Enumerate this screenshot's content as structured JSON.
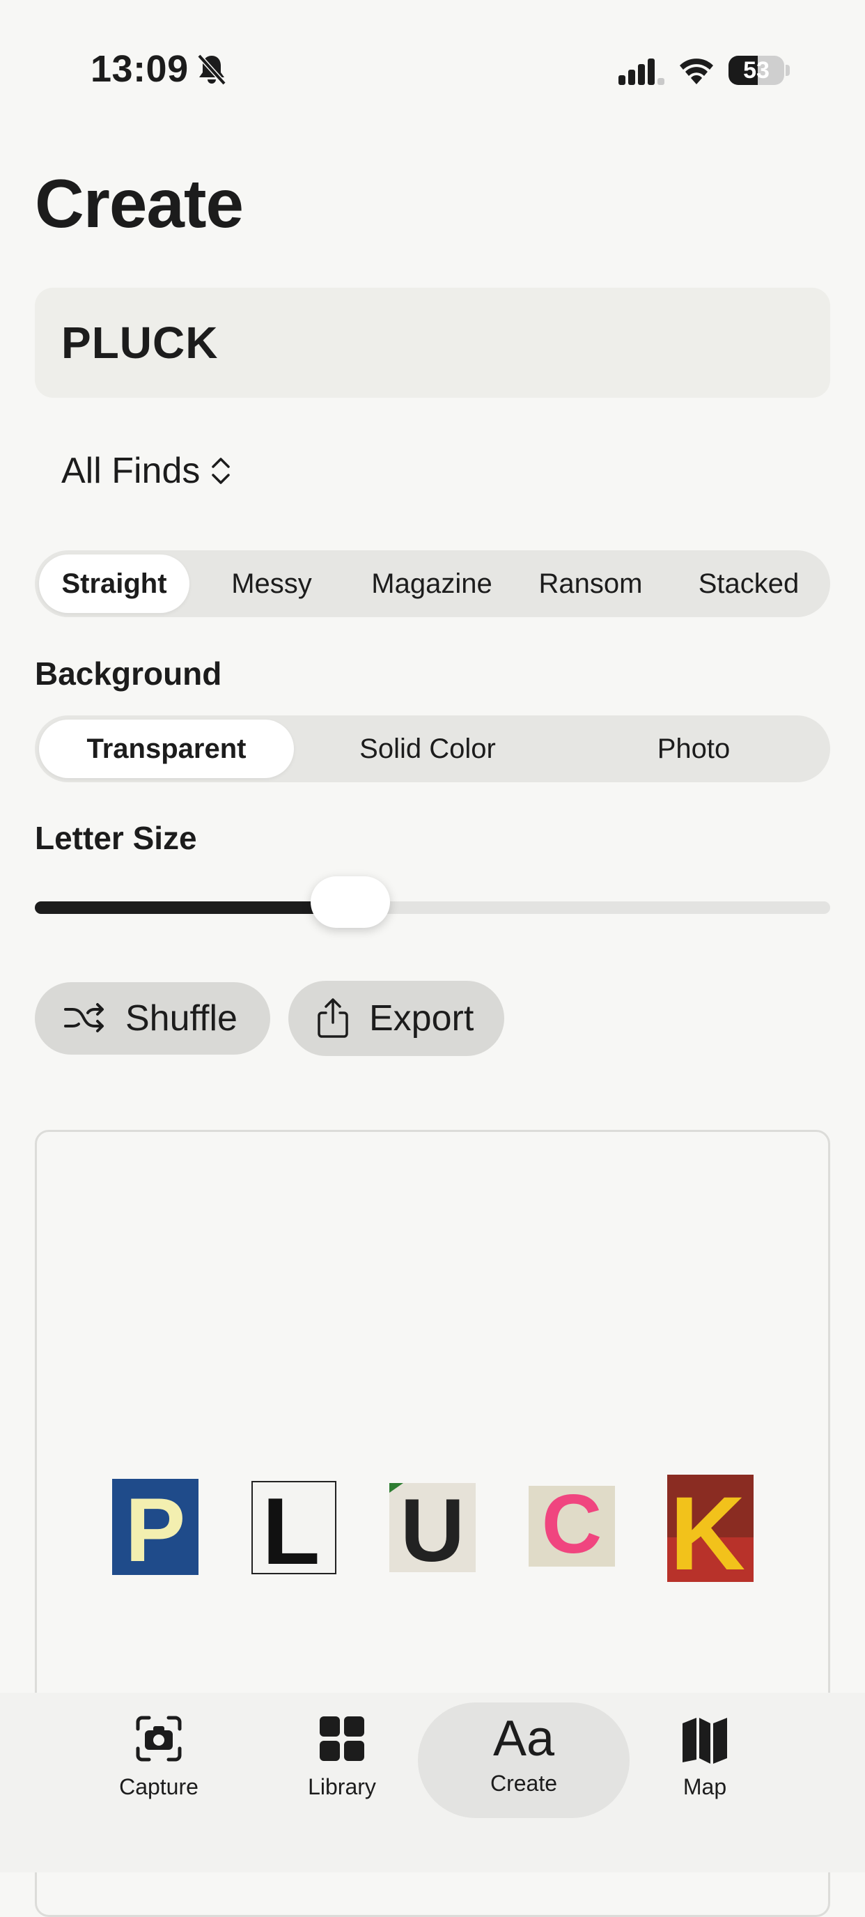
{
  "status_bar": {
    "time": "13:09",
    "battery_level": "53",
    "battery_fraction": 0.53,
    "icons": [
      "bell-slash-icon",
      "cellular-signal-icon",
      "wifi-icon",
      "battery-icon"
    ]
  },
  "page": {
    "title": "Create"
  },
  "text_input": {
    "value": "PLUCK"
  },
  "source_picker": {
    "label": "All Finds",
    "icon": "chevron-up-down-icon"
  },
  "style_segments": {
    "items": [
      "Straight",
      "Messy",
      "Magazine",
      "Ransom",
      "Stacked"
    ],
    "selected": "Straight"
  },
  "background": {
    "label": "Background",
    "items": [
      "Transparent",
      "Solid Color",
      "Photo"
    ],
    "selected": "Transparent"
  },
  "letter_size": {
    "label": "Letter Size",
    "value_fraction": 0.397
  },
  "actions": {
    "shuffle_label": "Shuffle",
    "shuffle_icon": "shuffle-icon",
    "export_label": "Export",
    "export_icon": "share-icon"
  },
  "preview": {
    "letters": [
      "P",
      "L",
      "U",
      "C",
      "K"
    ],
    "colors": {
      "p_bg": "#1f4b8a",
      "p_fg": "#f3efb0",
      "l_bg": "#f4f4f2",
      "u_bg": "#e6e2d8",
      "c_bg": "#e0dbc8",
      "c_fg": "#f0457f",
      "k_bg": "#8a2c22",
      "k_fg": "#f2c21b"
    }
  },
  "tab_bar": {
    "tabs": [
      {
        "label": "Capture",
        "icon": "camera-icon"
      },
      {
        "label": "Library",
        "icon": "grid-icon"
      },
      {
        "label": "Create",
        "icon": "text-aa-icon",
        "glyph": "Aa"
      },
      {
        "label": "Map",
        "icon": "map-icon"
      }
    ],
    "selected": "Create"
  }
}
